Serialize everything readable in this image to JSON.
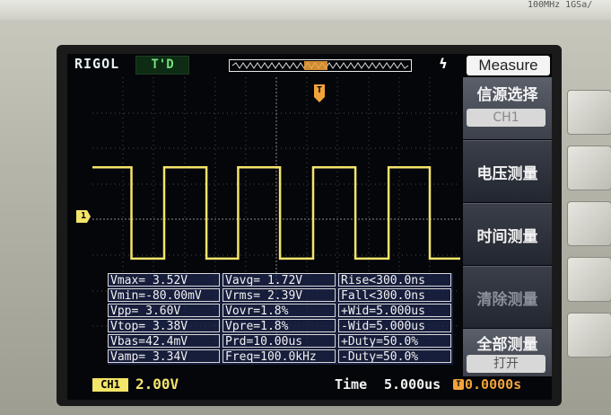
{
  "header": {
    "logo": "RIGOL",
    "trigger_state": "T'D",
    "measure_title": "Measure",
    "bezel_text": "100MHz 1GSa/"
  },
  "menu": {
    "source_label": "信源选择",
    "source_value": "CH1",
    "voltage_label": "电压测量",
    "time_label": "时间测量",
    "clear_label": "清除测量",
    "all_label": "全部测量",
    "all_value": "打开"
  },
  "measurements": {
    "col1": [
      "Vmax= 3.52V",
      "Vmin=-80.00mV",
      "Vpp= 3.60V",
      "Vtop= 3.38V",
      "Vbas=42.4mV",
      "Vamp= 3.34V"
    ],
    "col2": [
      "Vavg= 1.72V",
      "Vrms= 2.39V",
      "Vovr=1.8%",
      "Vpre=1.8%",
      "Prd=10.00us",
      "Freq=100.0kHz"
    ],
    "col3": [
      "Rise<300.0ns",
      "Fall<300.0ns",
      "+Wid=5.000us",
      "-Wid=5.000us",
      "+Duty=50.0%",
      "-Duty=50.0%"
    ]
  },
  "footer": {
    "channel_badge": "CH1",
    "channel_scale": "2.00V",
    "time_label": "Time",
    "time_value": "5.000us",
    "trigger_position": "0.0000s"
  },
  "markers": {
    "channel_marker": "1",
    "trigger_marker": "T"
  },
  "waveform": {
    "trace_color": "#f3e46a",
    "high_fraction": 0.455,
    "low_fraction": 0.7,
    "periods": [
      {
        "rise": 0.0,
        "fall": 0.106
      },
      {
        "rise": 0.195,
        "fall": 0.31
      },
      {
        "rise": 0.396,
        "fall": 0.51
      },
      {
        "rise": 0.6,
        "fall": 0.715
      },
      {
        "rise": 0.805,
        "fall": 0.917
      }
    ]
  }
}
